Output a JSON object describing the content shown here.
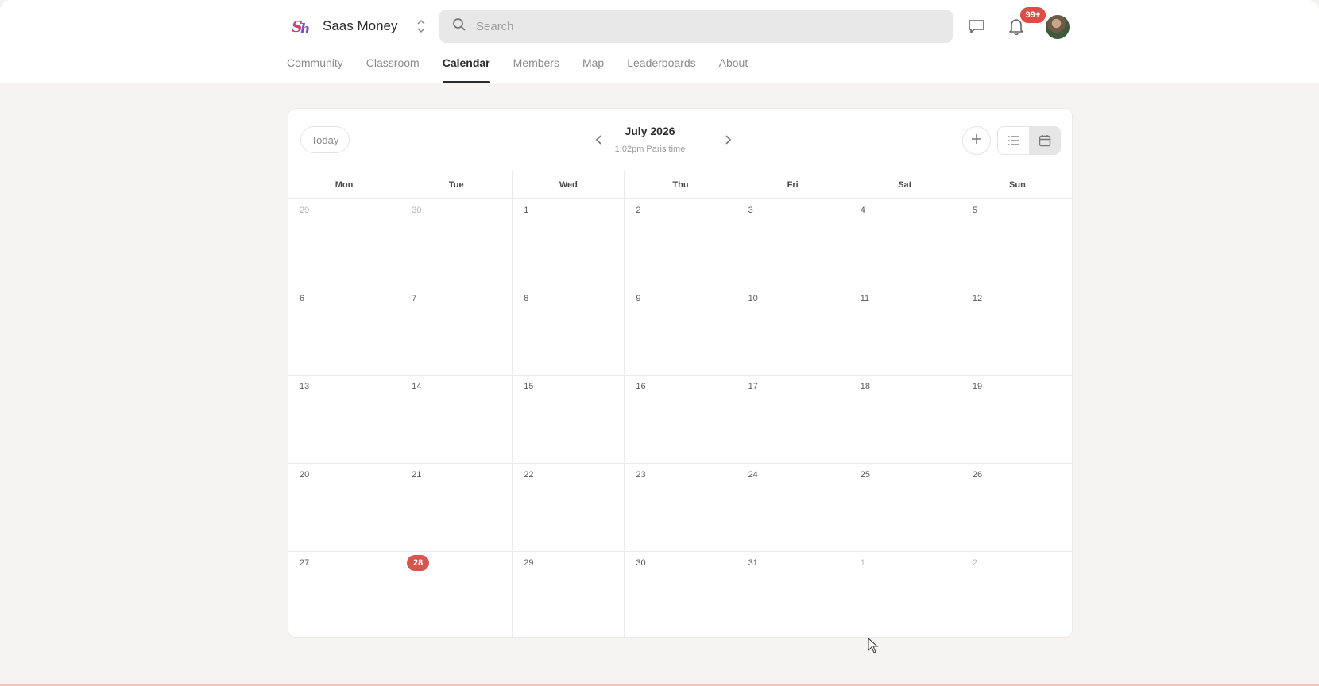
{
  "header": {
    "brand_name": "Saas Money",
    "logo_text": "Sh",
    "search_placeholder": "Search",
    "notification_count": "99+",
    "tabs": [
      {
        "label": "Community",
        "active": false
      },
      {
        "label": "Classroom",
        "active": false
      },
      {
        "label": "Calendar",
        "active": true
      },
      {
        "label": "Members",
        "active": false
      },
      {
        "label": "Map",
        "active": false
      },
      {
        "label": "Leaderboards",
        "active": false
      },
      {
        "label": "About",
        "active": false
      }
    ],
    "icons": [
      "search-icon",
      "chat-icon",
      "bell-icon",
      "switch-community-icon"
    ]
  },
  "calendar": {
    "today_label": "Today",
    "month_title": "July 2026",
    "time_subtitle": "1:02pm Paris time",
    "weekdays": [
      "Mon",
      "Tue",
      "Wed",
      "Thu",
      "Fri",
      "Sat",
      "Sun"
    ],
    "weeks": [
      [
        "29",
        "30",
        "1",
        "2",
        "3",
        "4",
        "5"
      ],
      [
        "6",
        "7",
        "8",
        "9",
        "10",
        "11",
        "12"
      ],
      [
        "13",
        "14",
        "15",
        "16",
        "17",
        "18",
        "19"
      ],
      [
        "20",
        "21",
        "22",
        "23",
        "24",
        "25",
        "26"
      ],
      [
        "27",
        "28",
        "29",
        "30",
        "31",
        "1",
        "2"
      ]
    ],
    "muted_cells": [
      [
        0,
        0
      ],
      [
        0,
        1
      ],
      [
        4,
        5
      ],
      [
        4,
        6
      ]
    ],
    "today_cell": [
      4,
      1
    ],
    "colors": {
      "accent": "#d9534f",
      "badge": "#e04b45"
    }
  }
}
